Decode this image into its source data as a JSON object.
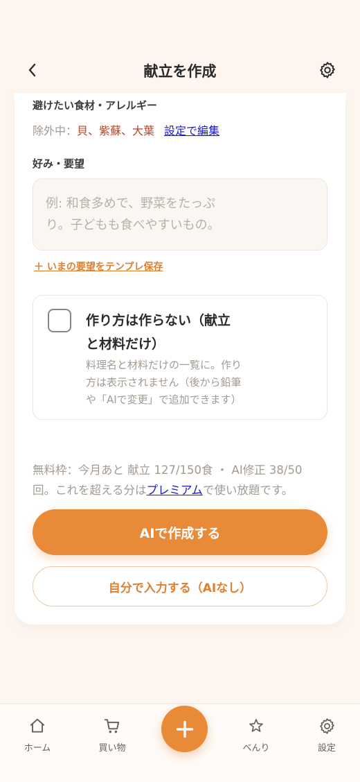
{
  "header": {
    "title": "献立を作成",
    "back_icon": "chevron-left-icon",
    "settings_icon": "gear-icon"
  },
  "avoid": {
    "label": "避けたい食材・アレルギー",
    "excluded_prefix": "除外中：",
    "excluded_items": "貝、紫蘇、大葉",
    "edit_link": "設定で編集"
  },
  "preferences": {
    "label": "好み・要望",
    "placeholder_line1": "例: 和食多めで、野菜をたっぷ",
    "placeholder_line2": "り。子どもも食べやすいもの。",
    "save_template_link": "＋ いまの要望をテンプレ保存"
  },
  "no_recipe_option": {
    "checked": false,
    "title_line1": "作り方は作らない（献立",
    "title_line2": "と材料だけ）",
    "desc_line1": "料理名と材料だけの一覧に。作り",
    "desc_line2": "方は表示されません（後から鉛筆",
    "desc_line3": "や「AIで変更」で追加できます）"
  },
  "quota": {
    "line1": "無料枠：今月あと 献立 127/150食 ・ AI修正 38/50",
    "line2_before": "回。これを超える分は",
    "premium_link": "プレミアム",
    "line2_after": "で使い放題です。"
  },
  "buttons": {
    "ai_create": "AIで作成する",
    "manual_input": "自分で入力する（AIなし）"
  },
  "tabbar": {
    "home": "ホーム",
    "shopping": "買い物",
    "add": "+",
    "favorites": "べんり",
    "settings": "設定"
  },
  "colors": {
    "accent": "#e88a38",
    "background": "#fdf6f0",
    "excluded_text": "#b7482a",
    "link": "#1a1acc"
  }
}
